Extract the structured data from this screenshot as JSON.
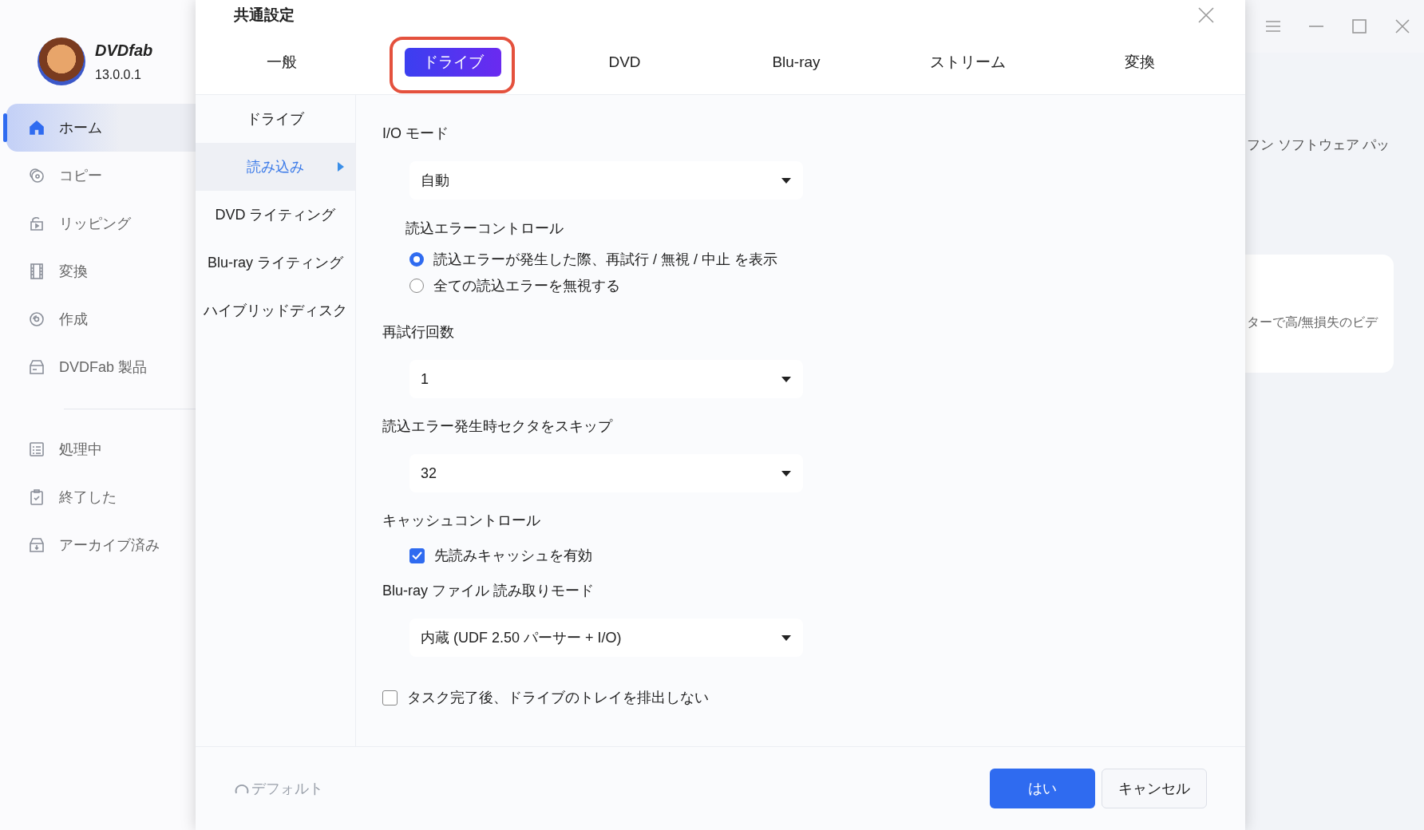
{
  "app": {
    "name": "DVDfab",
    "version": "13.0.0.1"
  },
  "sidebar": {
    "items": [
      {
        "label": "ホーム",
        "kind": "home",
        "selected": true
      },
      {
        "label": "コピー",
        "kind": "copy",
        "selected": false
      },
      {
        "label": "リッピング",
        "kind": "rip",
        "selected": false
      },
      {
        "label": "変換",
        "kind": "film",
        "selected": false
      },
      {
        "label": "作成",
        "kind": "disc",
        "selected": false
      },
      {
        "label": "DVDFab 製品",
        "kind": "box",
        "selected": false
      }
    ],
    "bottom_items": [
      {
        "label": "処理中",
        "kind": "list",
        "selected": false
      },
      {
        "label": "終了した",
        "kind": "clipboard",
        "selected": false
      },
      {
        "label": "アーカイブ済み",
        "kind": "archive",
        "selected": false
      }
    ]
  },
  "background": {
    "banner_text": "フン ソフトウェア パッ",
    "card_text": "ターで高/無損失のビデ"
  },
  "dialog": {
    "title": "共通設定",
    "tabs": [
      {
        "label": "一般",
        "selected": false,
        "highlighted": false
      },
      {
        "label": "ドライブ",
        "selected": true,
        "highlighted": true
      },
      {
        "label": "DVD",
        "selected": false,
        "highlighted": false
      },
      {
        "label": "Blu-ray",
        "selected": false,
        "highlighted": false
      },
      {
        "label": "ストリーム",
        "selected": false,
        "highlighted": false
      },
      {
        "label": "変換",
        "selected": false,
        "highlighted": false
      }
    ],
    "subnav": [
      {
        "label": "ドライブ",
        "selected": false
      },
      {
        "label": "読み込み",
        "selected": true
      },
      {
        "label": "DVD ライティング",
        "selected": false
      },
      {
        "label": "Blu-ray ライティング",
        "selected": false
      },
      {
        "label": "ハイブリッドディスク",
        "selected": false
      }
    ],
    "fields": [
      {
        "kind": "heading",
        "text": "I/O モード"
      },
      {
        "kind": "dropdown",
        "value": "自動"
      },
      {
        "kind": "subheading",
        "text": "読込エラーコントロール"
      },
      {
        "kind": "radio",
        "label": "読込エラーが発生した際、再試行 / 無視 / 中止 を表示",
        "selected": true
      },
      {
        "kind": "radio",
        "label": "全ての読込エラーを無視する",
        "selected": false
      },
      {
        "kind": "heading",
        "text": "再試行回数"
      },
      {
        "kind": "dropdown",
        "value": "1"
      },
      {
        "kind": "heading",
        "text": "読込エラー発生時セクタをスキップ"
      },
      {
        "kind": "dropdown",
        "value": "32"
      },
      {
        "kind": "heading",
        "text": "キャッシュコントロール"
      },
      {
        "kind": "checkbox",
        "label": "先読みキャッシュを有効",
        "checked": true
      },
      {
        "kind": "heading",
        "text": "Blu-ray ファイル  読み取りモード"
      },
      {
        "kind": "dropdown",
        "value": "内蔵 (UDF 2.50 パーサー + I/O)"
      },
      {
        "kind": "outer-checkbox",
        "label": "タスク完了後、ドライブのトレイを排出しない",
        "checked": false
      }
    ],
    "default_button": "デフォルト",
    "ok_button": "はい",
    "cancel_button": "キャンセル"
  }
}
